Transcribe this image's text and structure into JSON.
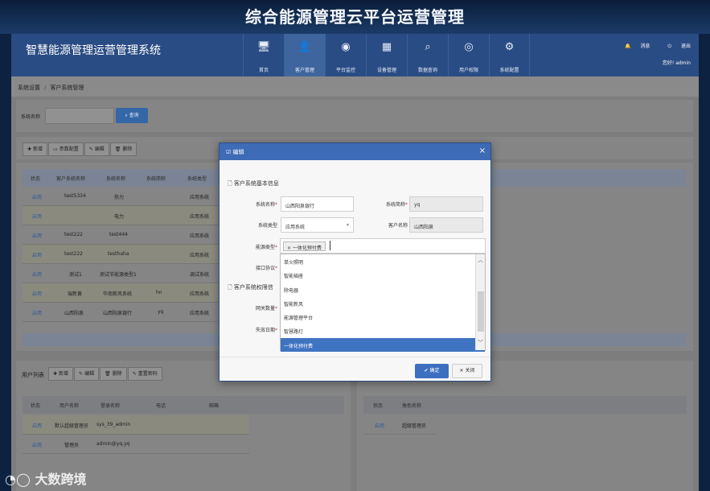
{
  "banner_title": "综合能源管理云平台运营管理",
  "app_title": "智慧能源管理运营管理系统",
  "nav": [
    {
      "icon": "🖥",
      "label": "首页"
    },
    {
      "icon": "👤",
      "label": "客户管理"
    },
    {
      "icon": "◉",
      "label": "平台监控"
    },
    {
      "icon": "▦",
      "label": "设备管理"
    },
    {
      "icon": "⌕",
      "label": "数据查询"
    },
    {
      "icon": "◎",
      "label": "用户权限"
    },
    {
      "icon": "⚙",
      "label": "系统配置"
    }
  ],
  "top_right": {
    "message": "消息",
    "logout": "退出",
    "greeting": "您好! admin"
  },
  "breadcrumb": {
    "parent": "系统设置",
    "current": "客户系统管理"
  },
  "search": {
    "label": "系统名称",
    "value": "",
    "button": "查询"
  },
  "toolbar": {
    "add": "新增",
    "params": "参数配置",
    "edit": "编辑",
    "delete": "删除"
  },
  "table": {
    "headers": [
      "状态",
      "客户系统名称",
      "系统名称",
      "系统简称",
      "系统类型"
    ],
    "rows": [
      {
        "status": "启用",
        "customer_system": "test5334",
        "system": "热力",
        "abbr": "",
        "type": "应用系统"
      },
      {
        "status": "启用",
        "customer_system": "",
        "system": "电力",
        "abbr": "",
        "type": "应用系统"
      },
      {
        "status": "启用",
        "customer_system": "test222",
        "system": "test444",
        "abbr": "",
        "type": "应用系统"
      },
      {
        "status": "启用",
        "customer_system": "test222",
        "system": "testhaha",
        "abbr": "",
        "type": "应用系统"
      },
      {
        "status": "启用",
        "customer_system": "测试1",
        "system": "测试节能源类型1",
        "abbr": "",
        "type": "调试系统"
      },
      {
        "status": "启用",
        "customer_system": "瑞新黄",
        "system": "华南新风系统",
        "abbr": "hn",
        "type": "应用系统"
      },
      {
        "status": "启用",
        "customer_system": "山西阳泉",
        "system": "山西阳泉银行",
        "abbr": "yq",
        "type": "应用系统"
      }
    ]
  },
  "users": {
    "title": "用户列表",
    "toolbar": {
      "add": "新增",
      "edit": "编辑",
      "delete": "删除",
      "reset": "重置密码"
    },
    "headers": [
      "状态",
      "用户名称",
      "登录名称",
      "电话",
      "邮箱"
    ],
    "rows": [
      {
        "status": "启用",
        "name": "默认超级管理员",
        "login": "sys_39_admin",
        "phone": "",
        "email": ""
      },
      {
        "status": "启用",
        "name": "管理员",
        "login": "admin@yq.yq",
        "phone": "",
        "email": ""
      }
    ]
  },
  "roles": {
    "headers": [
      "状态",
      "角色名称"
    ],
    "rows": [
      {
        "status": "启用",
        "name": "超级管理员"
      }
    ]
  },
  "modal": {
    "title": "编辑",
    "close": "×",
    "section1": "客户系统基本信息",
    "section2": "客户系统权限信",
    "fields": {
      "system_name_label": "系统名称",
      "system_name_value": "山西阳泉银行",
      "system_abbr_label": "系统简称",
      "system_abbr_value": "yq",
      "system_type_label": "系统类型",
      "system_type_value": "应用系统",
      "customer_name_label": "客户名称",
      "customer_name_value": "山西阳泉",
      "energy_type_label": "能源类型",
      "energy_type_tag": "× 一体化预付费",
      "protocol_label": "接口协议",
      "gateway_label": "网关数量",
      "expire_label": "失效日期"
    },
    "dropdown": [
      "单火照明",
      "智能插座",
      "除电器",
      "智能新风",
      "能源管理平台",
      "智慧路灯",
      "一体化预付费"
    ],
    "ok": "确定",
    "cancel": "关闭"
  },
  "watermark": "大数跨境"
}
